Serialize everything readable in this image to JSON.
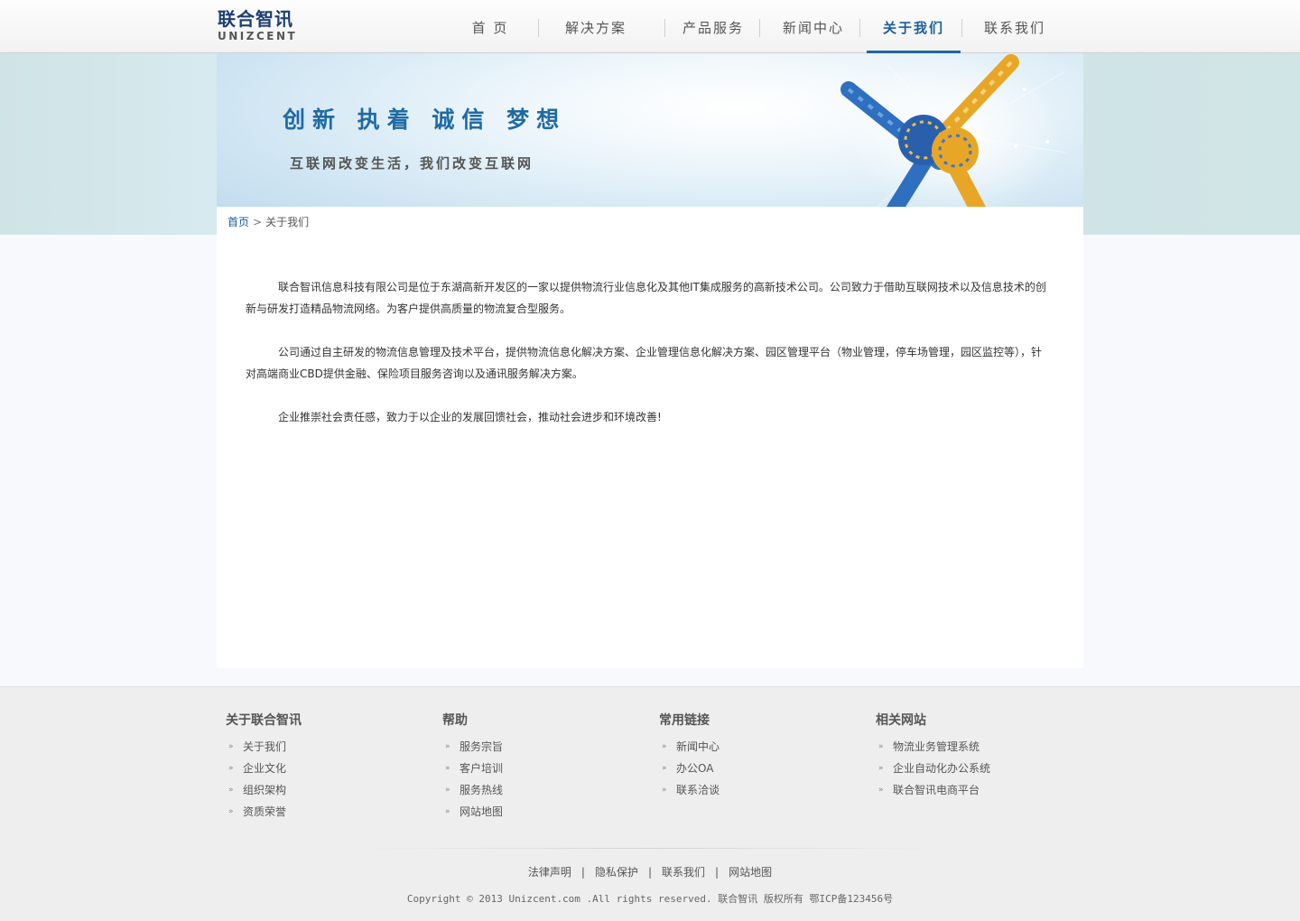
{
  "header": {
    "logo_cn": "联合智讯",
    "logo_en": "UNIZCENT",
    "nav": [
      {
        "label": "首 页"
      },
      {
        "label": "解决方案"
      },
      {
        "label": "产品服务"
      },
      {
        "label": "新闻中心"
      },
      {
        "label": "关于我们"
      },
      {
        "label": "联系我们"
      }
    ],
    "active_nav": "关于我们"
  },
  "banner": {
    "slogan": "创新 执着 诚信 梦想",
    "subtitle": "互联网改变生活，我们改变互联网"
  },
  "breadcrumb": {
    "home": "首页",
    "separator": ">",
    "current": "关于我们"
  },
  "article": {
    "paragraphs": [
      "联合智讯信息科技有限公司是位于东湖高新开发区的一家以提供物流行业信息化及其他IT集成服务的高新技术公司。公司致力于借助互联网技术以及信息技术的创新与研发打造精品物流网络。为客户提供高质量的物流复合型服务。",
      "公司通过自主研发的物流信息管理及技术平台，提供物流信息化解决方案、企业管理信息化解决方案、园区管理平台（物业管理，停车场管理，园区监控等），针对高端商业CBD提供金融、保险项目服务咨询以及通讯服务解决方案。",
      "企业推崇社会责任感，致力于以企业的发展回馈社会，推动社会进步和环境改善!"
    ]
  },
  "footer": {
    "columns": [
      {
        "title": "关于联合智讯",
        "items": [
          "关于我们",
          "企业文化",
          "组织架构",
          "资质荣誉"
        ]
      },
      {
        "title": "帮助",
        "items": [
          "服务宗旨",
          "客户培训",
          "服务热线",
          "网站地图"
        ]
      },
      {
        "title": "常用链接",
        "items": [
          "新闻中心",
          "办公OA",
          "联系洽谈"
        ]
      },
      {
        "title": "相关网站",
        "items": [
          "物流业务管理系统",
          "企业自动化办公系统",
          "联合智讯电商平台"
        ]
      }
    ],
    "bottom_links": [
      "法律声明",
      "隐私保护",
      "联系我们",
      "网站地图"
    ],
    "copyright": "Copyright © 2013  Unizcent.com .All rights reserved. 联合智讯 版权所有  鄂ICP备123456号"
  },
  "colors": {
    "accent": "#1f66a8",
    "logo": "#1c3f73",
    "footer_bg": "#eeeeee"
  },
  "icons": [
    "chevron-right-icon",
    "double-arrow-icon",
    "rope-knot-image"
  ]
}
